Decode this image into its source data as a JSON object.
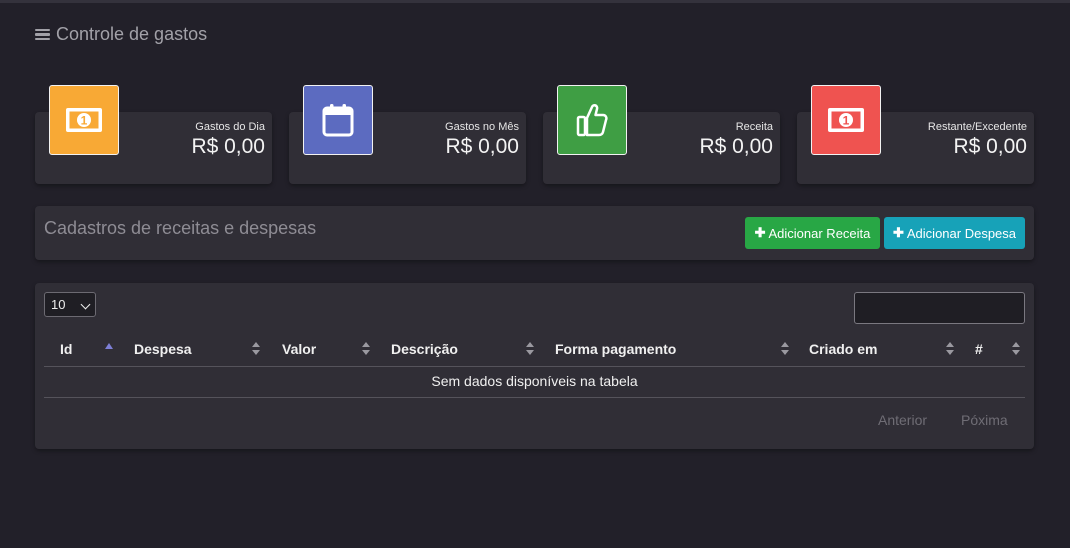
{
  "app": {
    "title": "Controle de gastos",
    "menu_icon": "bars-icon"
  },
  "cards": [
    {
      "label": "Gastos do Dia",
      "value": "R$ 0,00",
      "icon": "money-bill-icon",
      "color": "#f8a935"
    },
    {
      "label": "Gastos no Mês",
      "value": "R$ 0,00",
      "icon": "calendar-icon",
      "color": "#5c6bc0"
    },
    {
      "label": "Receita",
      "value": "R$ 0,00",
      "icon": "thumbs-up-icon",
      "color": "#3f9e44"
    },
    {
      "label": "Restante/Excedente",
      "value": "R$ 0,00",
      "icon": "money-bill-icon",
      "color": "#ef5350"
    }
  ],
  "cadastros": {
    "title": "Cadastros de receitas e despesas",
    "add_receita_label": "Adicionar Receita",
    "add_despesa_label": "Adicionar Despesa",
    "receita_color": "#28a745",
    "despesa_color": "#17a2b8"
  },
  "table": {
    "page_length": "10",
    "search_value": "",
    "columns": [
      "Id",
      "Despesa",
      "Valor",
      "Descrição",
      "Forma pagamento",
      "Criado em",
      "#"
    ],
    "sorted_column": "Id",
    "empty_message": "Sem dados disponíveis na tabela",
    "prev_label": "Anterior",
    "next_label": "Póxima"
  }
}
